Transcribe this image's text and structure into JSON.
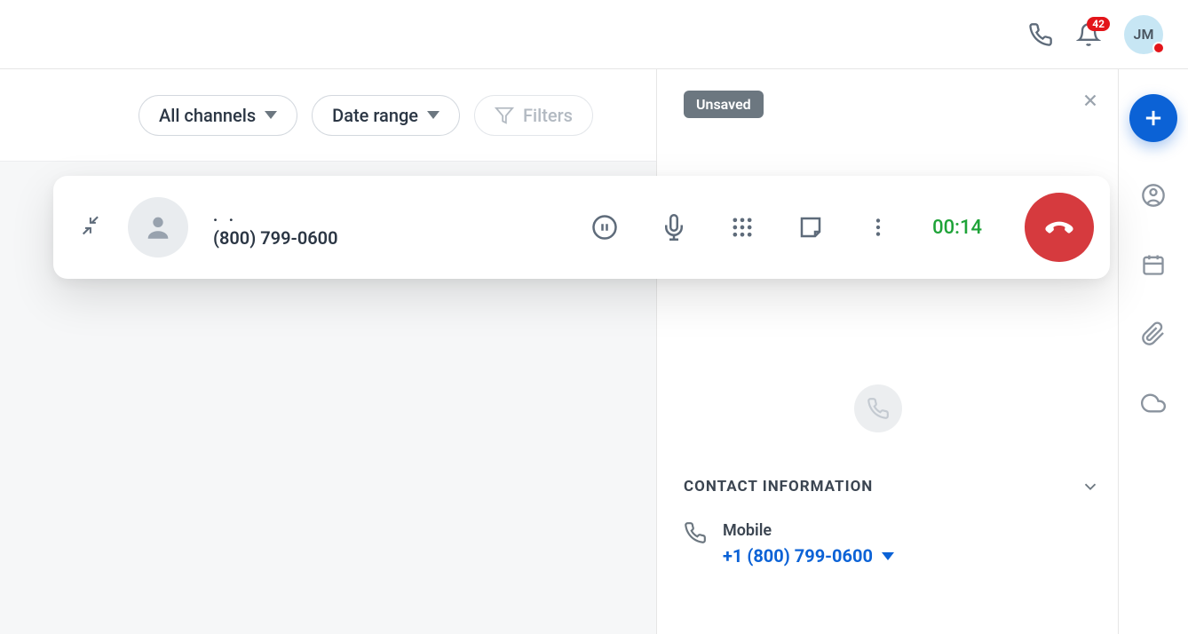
{
  "header": {
    "notification_count": "42",
    "avatar_initials": "JM"
  },
  "toolbar": {
    "channels_label": "All channels",
    "date_label": "Date range",
    "filters_label": "Filters"
  },
  "call": {
    "caller_name": ". .",
    "caller_number": "(800) 799-0600",
    "timer": "00:14"
  },
  "right": {
    "tag": "Unsaved",
    "section_title": "CONTACT INFORMATION",
    "contact_label": "Mobile",
    "contact_value": "+1 (800) 799-0600"
  }
}
